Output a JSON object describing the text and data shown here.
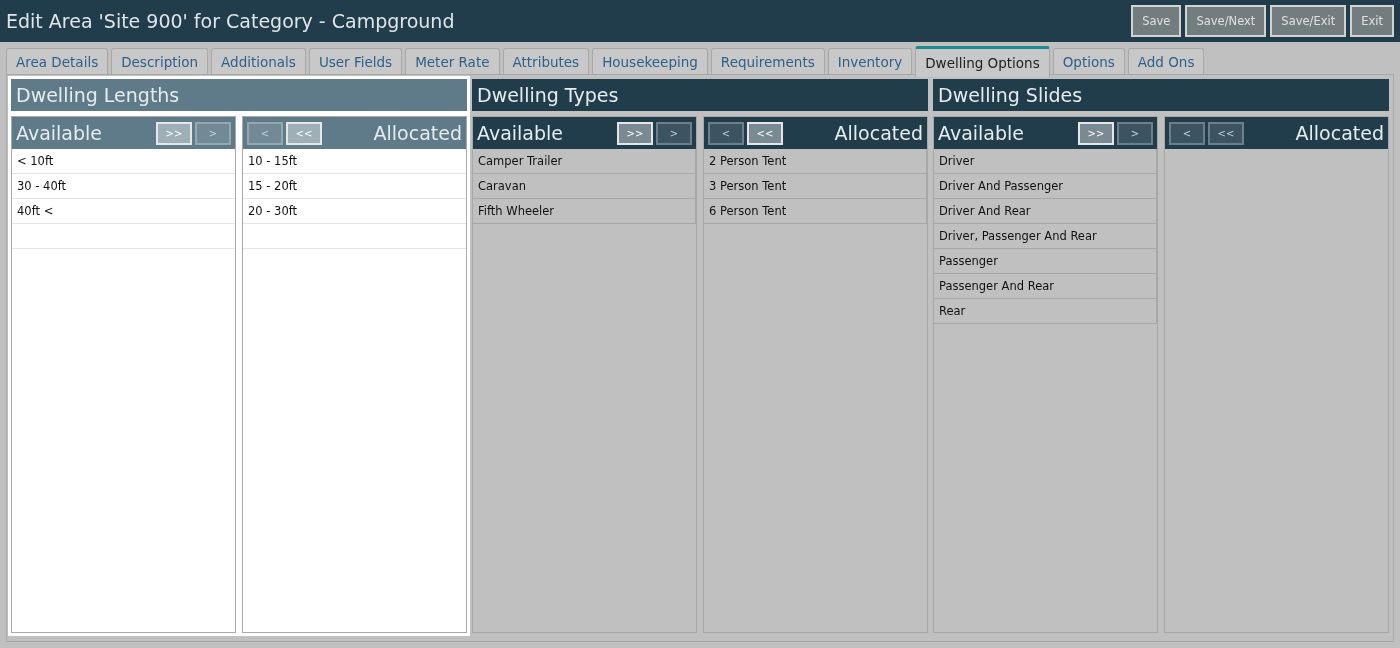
{
  "window": {
    "title": "Edit Area 'Site 900' for Category - Campground"
  },
  "actions": [
    {
      "label": "Save"
    },
    {
      "label": "Save/Next"
    },
    {
      "label": "Save/Exit"
    },
    {
      "label": "Exit"
    }
  ],
  "tabs": [
    {
      "label": "Area Details",
      "selected": false
    },
    {
      "label": "Description",
      "selected": false
    },
    {
      "label": "Additionals",
      "selected": false
    },
    {
      "label": "User Fields",
      "selected": false
    },
    {
      "label": "Meter Rate",
      "selected": false
    },
    {
      "label": "Attributes",
      "selected": false
    },
    {
      "label": "Housekeeping",
      "selected": false
    },
    {
      "label": "Requirements",
      "selected": false
    },
    {
      "label": "Inventory",
      "selected": false
    },
    {
      "label": "Dwelling Options",
      "selected": true
    },
    {
      "label": "Options",
      "selected": false
    },
    {
      "label": "Add Ons",
      "selected": false
    }
  ],
  "sections": [
    {
      "title": "Dwelling Lengths",
      "highlighted": true,
      "lists": [
        {
          "kind": "available",
          "title": "Available",
          "buttons": [
            {
              "label": ">>",
              "disabled": false
            },
            {
              "label": ">",
              "disabled": true
            }
          ],
          "items": [
            "< 10ft",
            "30 - 40ft",
            "40ft <"
          ]
        },
        {
          "kind": "allocated",
          "title": "Allocated",
          "buttons": [
            {
              "label": "<",
              "disabled": true
            },
            {
              "label": "<<",
              "disabled": false
            }
          ],
          "items": [
            "10 - 15ft",
            "15 - 20ft",
            "20 - 30ft"
          ]
        }
      ]
    },
    {
      "title": "Dwelling Types",
      "highlighted": false,
      "lists": [
        {
          "kind": "available",
          "title": "Available",
          "buttons": [
            {
              "label": ">>",
              "disabled": false
            },
            {
              "label": ">",
              "disabled": true
            }
          ],
          "items": [
            "Camper Trailer",
            "Caravan",
            "Fifth Wheeler"
          ]
        },
        {
          "kind": "allocated",
          "title": "Allocated",
          "buttons": [
            {
              "label": "<",
              "disabled": true
            },
            {
              "label": "<<",
              "disabled": false
            }
          ],
          "items": [
            "2 Person Tent",
            "3 Person Tent",
            "6 Person Tent"
          ]
        }
      ]
    },
    {
      "title": "Dwelling Slides",
      "highlighted": false,
      "lists": [
        {
          "kind": "available",
          "title": "Available",
          "buttons": [
            {
              "label": ">>",
              "disabled": false
            },
            {
              "label": ">",
              "disabled": true
            }
          ],
          "items": [
            "Driver",
            "Driver And Passenger",
            "Driver And Rear",
            "Driver, Passenger And Rear",
            "Passenger",
            "Passenger And Rear",
            "Rear"
          ]
        },
        {
          "kind": "allocated",
          "title": "Allocated",
          "buttons": [
            {
              "label": "<",
              "disabled": true
            },
            {
              "label": "<<",
              "disabled": true
            }
          ]
        }
      ]
    }
  ]
}
